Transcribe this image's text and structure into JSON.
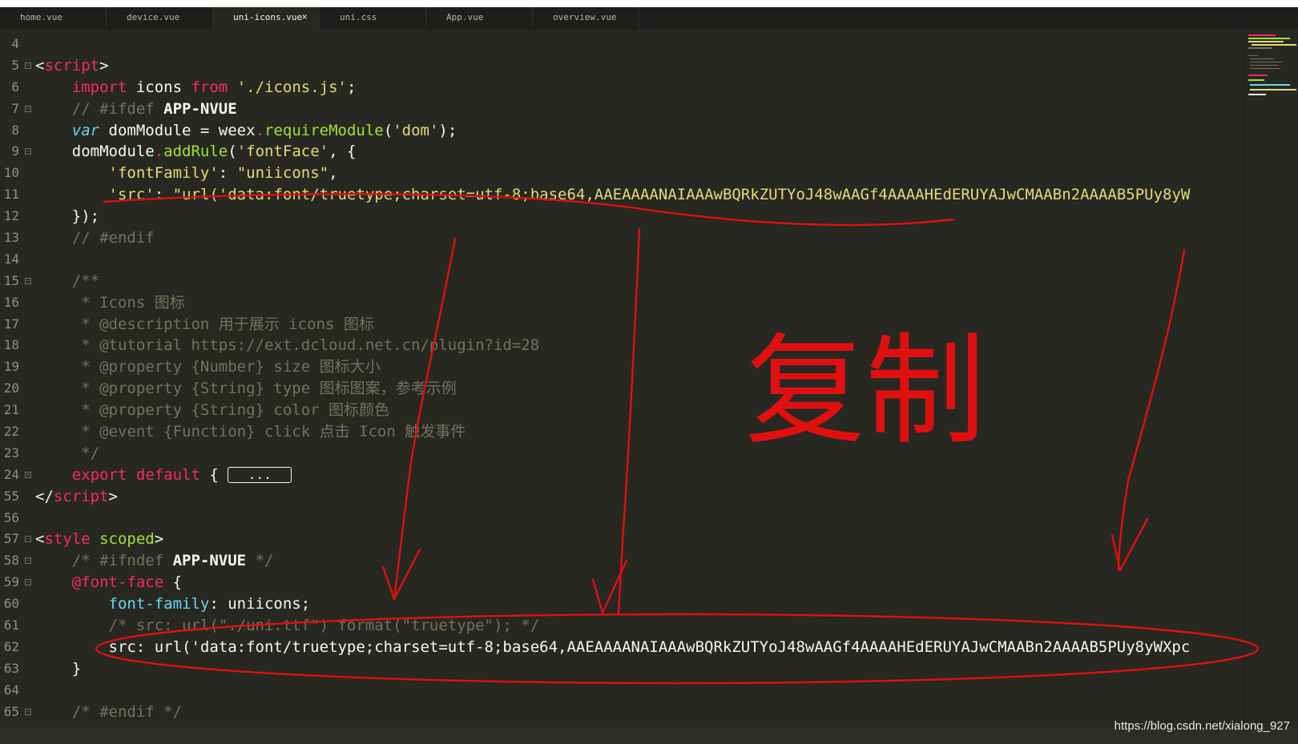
{
  "tabs": [
    {
      "label": "home.vue"
    },
    {
      "label": "device.vue"
    },
    {
      "label": "uni-icons.vue",
      "close": "×"
    },
    {
      "label": "uni.css"
    },
    {
      "label": "App.vue"
    },
    {
      "label": "overview.vue"
    }
  ],
  "lines": {
    "n4": "4",
    "n5": "5",
    "n6": "6",
    "n7": "7",
    "n8": "8",
    "n9": "9",
    "n10": "10",
    "n11": "11",
    "n12": "12",
    "n13": "13",
    "n14": "14",
    "n15": "15",
    "n16": "16",
    "n17": "17",
    "n18": "18",
    "n19": "19",
    "n20": "20",
    "n21": "21",
    "n22": "22",
    "n23": "23",
    "n24": "24",
    "n55": "55",
    "n56": "56",
    "n57": "57",
    "n58": "58",
    "n59": "59",
    "n60": "60",
    "n61": "61",
    "n62": "62",
    "n63": "63",
    "n64": "64",
    "n65": "65"
  },
  "code": {
    "script_open": "script",
    "import_kw": "import",
    "import_name": " icons ",
    "from_kw": "from",
    "import_path": "'./icons.js'",
    "ifdef_comment": "// #ifdef ",
    "ifdef_platform": "APP-NVUE",
    "var_kw": "var",
    "dom_module_decl": " domModule = weex",
    "require_fn": "requireModule",
    "dom_string": "'dom'",
    "dom_module_call": "domModule",
    "add_rule_fn": "addRule",
    "font_face_string": "'fontFace'",
    "font_family_key": "'fontFamily'",
    "font_family_value": "\"uniicons\"",
    "src_key": "'src'",
    "src_value": "\"url('data:font/truetype;charset=utf-8;base64,AAEAAAANAIAAAwBQRkZUTYoJ48wAAGf4AAAAHEdERUYAJwCMAABn2AAAAB5PUy8yW",
    "endif_comment": "// #endif",
    "doc_open": "/**",
    "doc_icons": " * Icons 图标",
    "doc_description": " * @description 用于展示 icons 图标",
    "doc_tutorial": " * @tutorial https://ext.dcloud.net.cn/plugin?id=28",
    "doc_size": " * @property {Number} size 图标大小",
    "doc_type": " * @property {String} type 图标图案，参考示例",
    "doc_color": " * @property {String} color 图标颜色",
    "doc_event": " * @event {Function} click 点击 Icon 触发事件",
    "doc_close": " */",
    "export_kw": "export default",
    "export_brace": " { ",
    "fold_ellipsis": "...",
    "script_close": "script",
    "style_tag": "style",
    "scoped_attr": "scoped",
    "ifndef_comment": "/* #ifndef ",
    "ifndef_platform": "APP-NVUE",
    "ifndef_comment_end": " */",
    "font_face_rule": "@font-face",
    "font_family_prop": "font-family",
    "font_family_val": ": uniicons;",
    "commented_src": "/* src: url(\"./uni.ttf\") format(\"truetype\"); */",
    "src_line": "src: url('data:font/truetype;charset=utf-8;base64,AAEAAAANAIAAAwBQRkZUTYoJ48wAAGf4AAAAHEdERUYAJwCMAABn2AAAAB5PUy8yWXpc",
    "close_brace": "}",
    "endif_block_comment": "/* #endif */"
  },
  "annotation": {
    "copy_text": "复制",
    "color": "#e01010"
  },
  "watermark": "https://blog.csdn.net/xialong_927",
  "colors": {
    "background": "#272822",
    "keyword": "#f92672",
    "function": "#a6e22e",
    "string": "#e6db74",
    "comment": "#75715e",
    "type": "#66d9ef"
  }
}
